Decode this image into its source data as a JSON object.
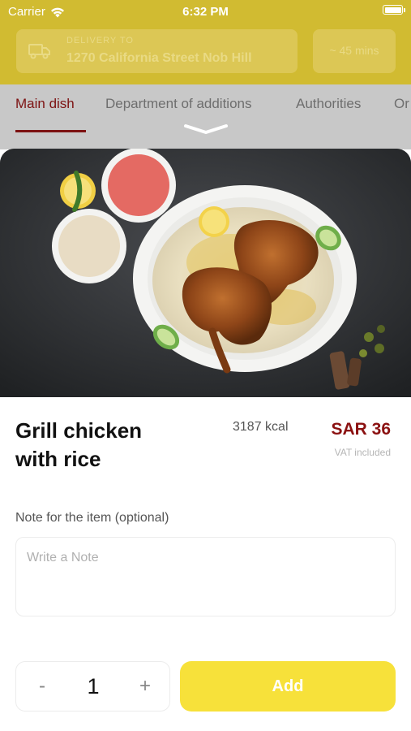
{
  "status_bar": {
    "carrier": "Carrier",
    "time": "6:32 PM"
  },
  "header": {
    "delivery_label": "DELIVERY TO",
    "delivery_address": "1270 California Street Nob Hill",
    "eta": "~ 45 mins"
  },
  "tabs": [
    {
      "label": "Main dish",
      "active": true
    },
    {
      "label": "Department of additions",
      "active": false
    },
    {
      "label": "Authorities",
      "active": false
    },
    {
      "label": "Or",
      "active": false
    }
  ],
  "dish": {
    "name": "Grill chicken with rice",
    "kcal": "3187 kcal",
    "price": "SAR 36",
    "vat_note": "VAT included"
  },
  "note": {
    "label": "Note for the item (optional)",
    "placeholder": "Write a Note",
    "value": ""
  },
  "quantity": {
    "minus": "-",
    "value": "1",
    "plus": "+"
  },
  "add_button_label": "Add",
  "colors": {
    "header_yellow": "#d1bb31",
    "accent_red": "#8b1111",
    "add_yellow": "#f7e13a"
  }
}
